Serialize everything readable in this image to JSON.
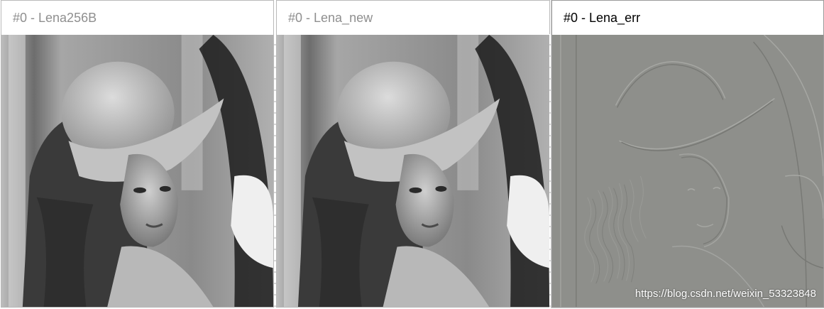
{
  "windows": [
    {
      "title": "#0 - Lena256B",
      "state": "inactive",
      "image": "grayscale-portrait-original"
    },
    {
      "title": "#0 - Lena_new",
      "state": "inactive",
      "image": "grayscale-portrait-reconstructed"
    },
    {
      "title": "#0 - Lena_err",
      "state": "active",
      "image": "error-emboss-image"
    }
  ],
  "watermark": "https://blog.csdn.net/weixin_53323848",
  "colors": {
    "title_inactive": "#8f8f8f",
    "title_active": "#000000",
    "error_background": "#8e8f8b"
  }
}
